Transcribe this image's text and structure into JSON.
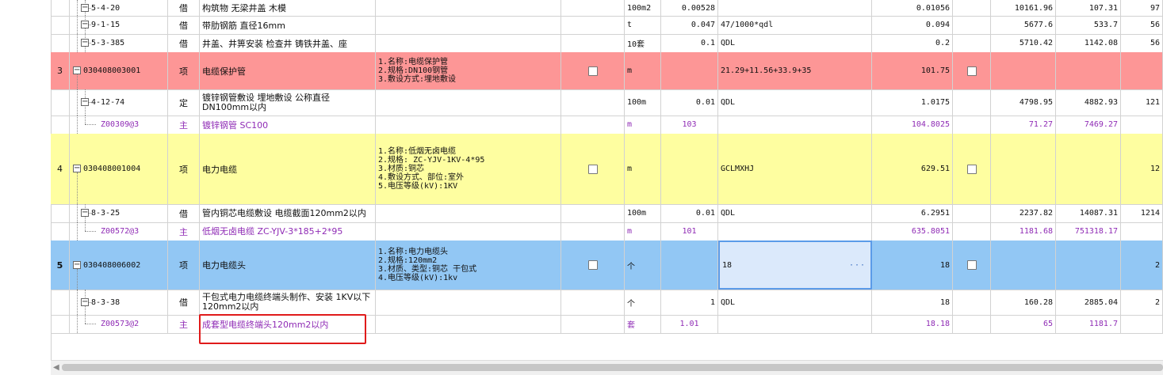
{
  "rows": [
    {
      "kind": "sub",
      "no": "",
      "code": "5-4-20",
      "type": "借",
      "name": "构筑物 无梁井盖 木模",
      "feature": "",
      "unit": "100m2",
      "qty": "0.00528",
      "formula": "",
      "engqty": "0.01056",
      "price": "10161.96",
      "total": "107.31",
      "last": "97"
    },
    {
      "kind": "sub",
      "no": "",
      "code": "9-1-15",
      "type": "借",
      "name": "带肋钢筋 直径16mm",
      "feature": "",
      "unit": "t",
      "qty": "0.047",
      "formula": "47/1000*qdl",
      "engqty": "0.094",
      "price": "5677.6",
      "total": "533.7",
      "last": "56"
    },
    {
      "kind": "sub",
      "no": "",
      "code": "5-3-385",
      "type": "借",
      "name": "井盖、井箅安装 检查井 铸铁井盖、座",
      "feature": "",
      "unit": "10套",
      "qty": "0.1",
      "formula": "QDL",
      "engqty": "0.2",
      "price": "5710.42",
      "total": "1142.08",
      "last": "56"
    },
    {
      "kind": "main",
      "no": "3",
      "code": "030408003001",
      "type": "项",
      "name": "电缆保护管",
      "feature": "1.名称:电缆保护管\n2.规格:DN100钢管\n3.敷设方式:埋地敷设",
      "unit": "m",
      "qty": "",
      "formula": "21.29+11.56+33.9+35",
      "engqty": "101.75",
      "price": "",
      "total": "",
      "last": ""
    },
    {
      "kind": "sub",
      "no": "",
      "code": "4-12-74",
      "type": "定",
      "name": "镀锌钢管敷设 埋地敷设 公称直径DN100mm以内",
      "feature": "",
      "unit": "100m",
      "qty": "0.01",
      "formula": "QDL",
      "engqty": "1.0175",
      "price": "4798.95",
      "total": "4882.93",
      "last": "121"
    },
    {
      "kind": "mat",
      "no": "",
      "code": "Z00309@3",
      "type": "主",
      "name": "镀锌钢管 SC100",
      "feature": "",
      "unit": "m",
      "qty": "103",
      "formula": "",
      "engqty": "104.8025",
      "price": "71.27",
      "total": "7469.27",
      "last": ""
    },
    {
      "kind": "main",
      "no": "4",
      "code": "030408001004",
      "type": "项",
      "name": "电力电缆",
      "feature": "1.名称:低烟无卤电缆\n2.规格: ZC-YJV-1KV-4*95\n3.材质:铜芯\n4.敷设方式、部位:室外\n5.电压等级(kV):1KV",
      "unit": "m",
      "qty": "",
      "formula": "GCLMXHJ",
      "engqty": "629.51",
      "price": "",
      "total": "",
      "last": "12"
    },
    {
      "kind": "sub",
      "no": "",
      "code": "8-3-25",
      "type": "借",
      "name": "管内铜芯电缆敷设 电缆截面120mm2以内",
      "feature": "",
      "unit": "100m",
      "qty": "0.01",
      "formula": "QDL",
      "engqty": "6.2951",
      "price": "2237.82",
      "total": "14087.31",
      "last": "1214"
    },
    {
      "kind": "mat",
      "no": "",
      "code": "Z00572@3",
      "type": "主",
      "name": "低烟无卤电缆 ZC-YJV-3*185+2*95",
      "feature": "",
      "unit": "m",
      "qty": "101",
      "formula": "",
      "engqty": "635.8051",
      "price": "1181.68",
      "total": "751318.17",
      "last": ""
    },
    {
      "kind": "main",
      "no": "5",
      "code": "030408006002",
      "type": "项",
      "name": "电力电缆头",
      "feature": "1.名称:电力电缆头\n2.规格:120mm2\n3.材质、类型:铜芯 干包式\n4.电压等级(kV):1kv",
      "unit": "个",
      "qty": "",
      "formula": "18",
      "engqty": "18",
      "price": "",
      "total": "",
      "last": "2"
    },
    {
      "kind": "sub",
      "no": "",
      "code": "8-3-38",
      "type": "借",
      "name": "干包式电力电缆终端头制作、安装 1KV以下 120mm2以内",
      "feature": "",
      "unit": "个",
      "qty": "1",
      "formula": "QDL",
      "engqty": "18",
      "price": "160.28",
      "total": "2885.04",
      "last": "2"
    },
    {
      "kind": "mat",
      "no": "",
      "code": "Z00573@2",
      "type": "主",
      "name": "成套型电缆终端头120mm2以内",
      "feature": "",
      "unit": "套",
      "qty": "1.01",
      "formula": "",
      "engqty": "18.18",
      "price": "65",
      "total": "1181.7",
      "last": ""
    }
  ],
  "colors": {
    "main_red": "#fd9696",
    "main_yellow": "#fefea0",
    "main_blue": "#92c7f4",
    "selected_blue": "#dbe9fb",
    "material_text": "#8f2bb5",
    "annotation": "#e01b1b"
  },
  "icons": {
    "collapse": "minus-box-icon",
    "edit": "ellipsis-icon",
    "scroll_left": "arrow-left-icon"
  },
  "selected": {
    "row": 9,
    "column": "formula"
  }
}
